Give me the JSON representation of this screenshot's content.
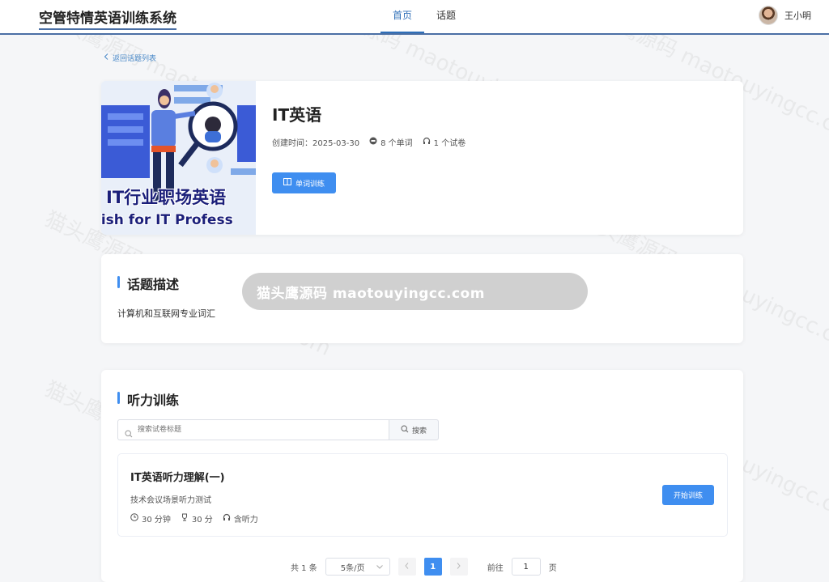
{
  "app": {
    "brand": "空管特情英语训练系统"
  },
  "nav": {
    "items": [
      {
        "label": "首页"
      },
      {
        "label": "话题"
      }
    ]
  },
  "user": {
    "name": "王小明"
  },
  "back": {
    "label": "返回话题列表"
  },
  "topic": {
    "cover_title": "IT行业职场英语",
    "cover_subtitle": "lish for IT Profess",
    "title": "IT英语",
    "created_label": "创建时间：2025-03-30",
    "word_count": "8 个单词",
    "exam_count": "1 个试卷",
    "word_training_label": "单词训练"
  },
  "description": {
    "heading": "话题描述",
    "text": "计算机和互联网专业词汇"
  },
  "listening": {
    "heading": "听力训练",
    "search_placeholder": "搜索试卷标题",
    "search_button": "搜索",
    "exams": [
      {
        "title": "IT英语听力理解(一)",
        "desc": "技术会议场景听力测试",
        "duration": "30 分钟",
        "score": "30 分",
        "audio": "含听力",
        "start_label": "开始训练"
      }
    ]
  },
  "pagination": {
    "total": "共 1 条",
    "page_size": "5条/页",
    "current_page": "1",
    "goto_prefix": "前往",
    "goto_value": "1",
    "goto_suffix": "页"
  },
  "watermark": {
    "text": "猫头鹰源码 maotouyingcc.com"
  },
  "colors": {
    "primary": "#3f8ef0",
    "brand_line": "#4a6fa5",
    "nav_active": "#2f6fb8"
  }
}
